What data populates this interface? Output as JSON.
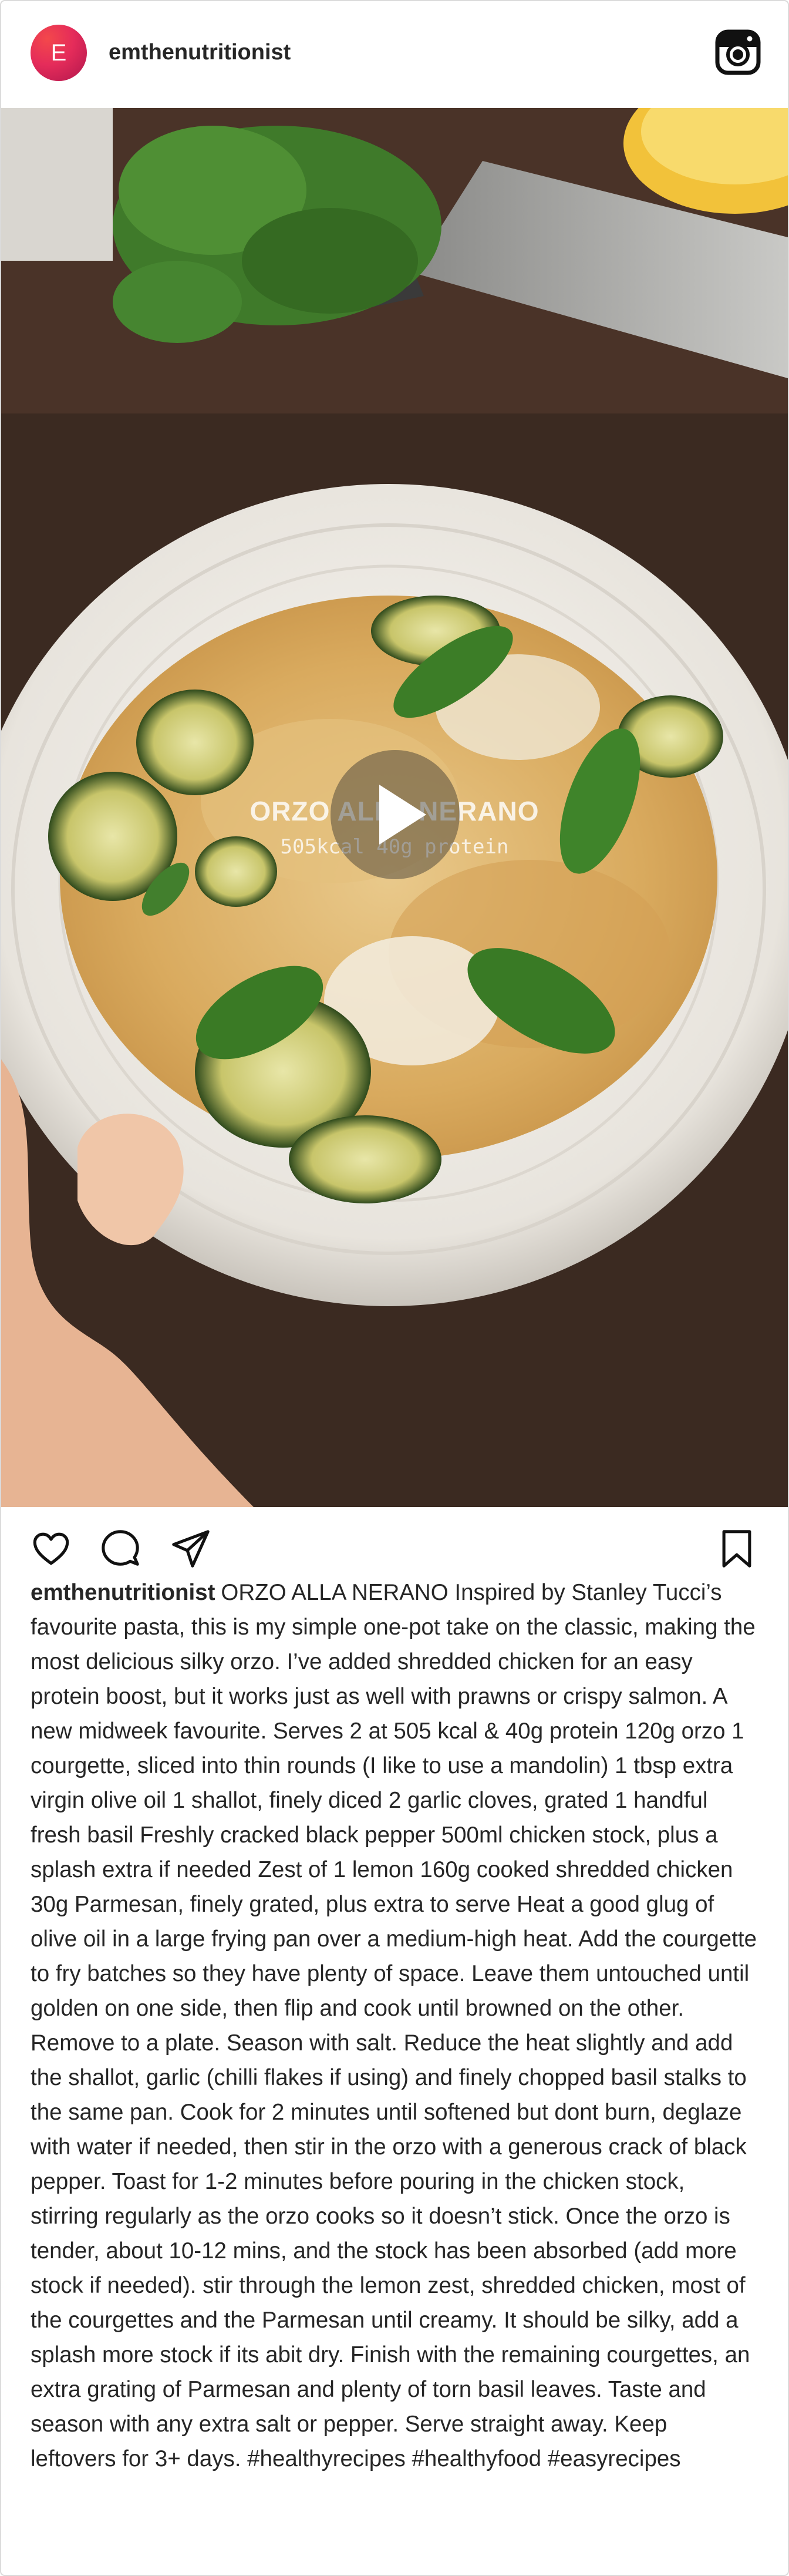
{
  "post": {
    "avatar_initial": "E",
    "username": "emthenutritionist",
    "icons": {
      "header": "instagram-icon",
      "media": "play-icon",
      "actions": [
        "heart-icon",
        "comment-icon",
        "share-icon",
        "bookmark-icon"
      ]
    },
    "video_overlay": {
      "title": "ORZO ALLA NERANO",
      "subtitle": "505kcal 40g protein"
    },
    "caption": {
      "username": "emthenutritionist",
      "text": "ORZO ALLA NERANO Inspired by Stanley Tucci’s favourite pasta, this is my simple one-pot take on the classic, making the most delicious silky orzo. I’ve added shredded chicken for an easy protein boost, but it works just as well with prawns or crispy salmon. A new midweek favourite. Serves 2 at 505 kcal & 40g protein 120g orzo 1 courgette, sliced into thin rounds (I like to use a mandolin) 1 tbsp extra virgin olive oil 1 shallot, finely diced 2 garlic cloves, grated 1 handful fresh basil Freshly cracked black pepper 500ml chicken stock, plus a splash extra if needed Zest of 1 lemon 160g cooked shredded chicken 30g Parmesan, finely grated, plus extra to serve Heat a good glug of olive oil in a large frying pan over a medium-high heat. Add the courgette to fry batches so they have plenty of space. Leave them untouched until golden on one side, then flip and cook until browned on the other. Remove to a plate. Season with salt. Reduce the heat slightly and add the shallot, garlic (chilli flakes if using) and finely chopped basil stalks to the same pan. Cook for 2 minutes until softened but dont burn, deglaze with water if needed, then stir in the orzo with a generous crack of black pepper. Toast for 1-2 minutes before pouring in the chicken stock, stirring regularly as the orzo cooks so it doesn’t stick. Once the orzo is tender, about 10-12 mins, and the stock has been absorbed (add more stock if needed). stir through the lemon zest, shredded chicken, most of the courgettes and the Parmesan until creamy. It should be silky, add a splash more stock if its abit dry. Finish with the remaining courgettes, an extra grating of Parmesan and plenty of torn basil leaves. Taste and season with any extra salt or pepper. Serve straight away. Keep leftovers for 3+ days. #healthyrecipes #healthyfood #easyrecipes"
    }
  },
  "colors": {
    "text": "#262626",
    "border": "#dbdbdb",
    "avatar": "#e52c5a"
  }
}
